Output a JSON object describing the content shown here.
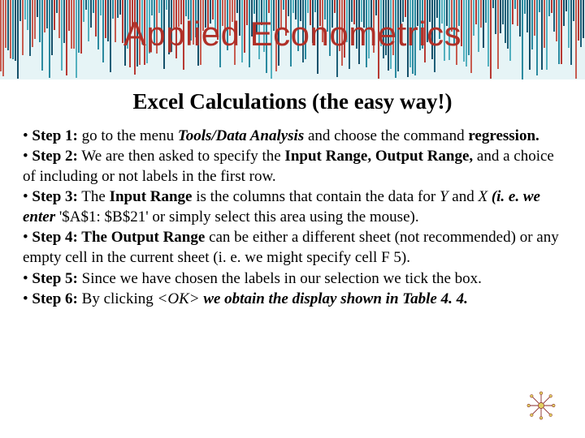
{
  "banner": {
    "title": "Applied Econometrics"
  },
  "subtitle": "Excel Calculations (the easy way!)",
  "steps": {
    "s1a": "• ",
    "s1b": "Step 1:",
    "s1c": " go to the menu ",
    "s1d": "Tools/Data Analysis",
    "s1e": " and choose the command ",
    "s1f": "regression.",
    "s2a": "• ",
    "s2b": "Step 2:",
    "s2c": " We are then asked to specify the ",
    "s2d": "Input Range, Output Range,",
    "s2e": " and a choice of including or not labels in the first row.",
    "s3a": "• ",
    "s3b": "Step 3:",
    "s3c": " The ",
    "s3d": "Input Range",
    "s3e": " is the columns that contain the data for ",
    "s3f": "Y",
    "s3g": " and ",
    "s3h": "X",
    "s3i": " ",
    "s3j": "(i. e. we enter",
    "s3k": " '$A$1: $B$21' or simply select this area using the mouse).",
    "s4a": "• ",
    "s4b": "Step 4: The Output Range",
    "s4c": " can be either a different sheet (not recommended) or any empty cell in the current sheet (i. e. we might specify cell F 5).",
    "s5a": "• ",
    "s5b": "Step 5:",
    "s5c": " Since we have chosen the labels in our selection we tick the box.",
    "s6a": "• ",
    "s6b": "Step 6:",
    "s6c": " By clicking ",
    "s6d": "<OK>",
    "s6e": " ",
    "s6f": "we obtain the display shown in Table 4. 4."
  }
}
